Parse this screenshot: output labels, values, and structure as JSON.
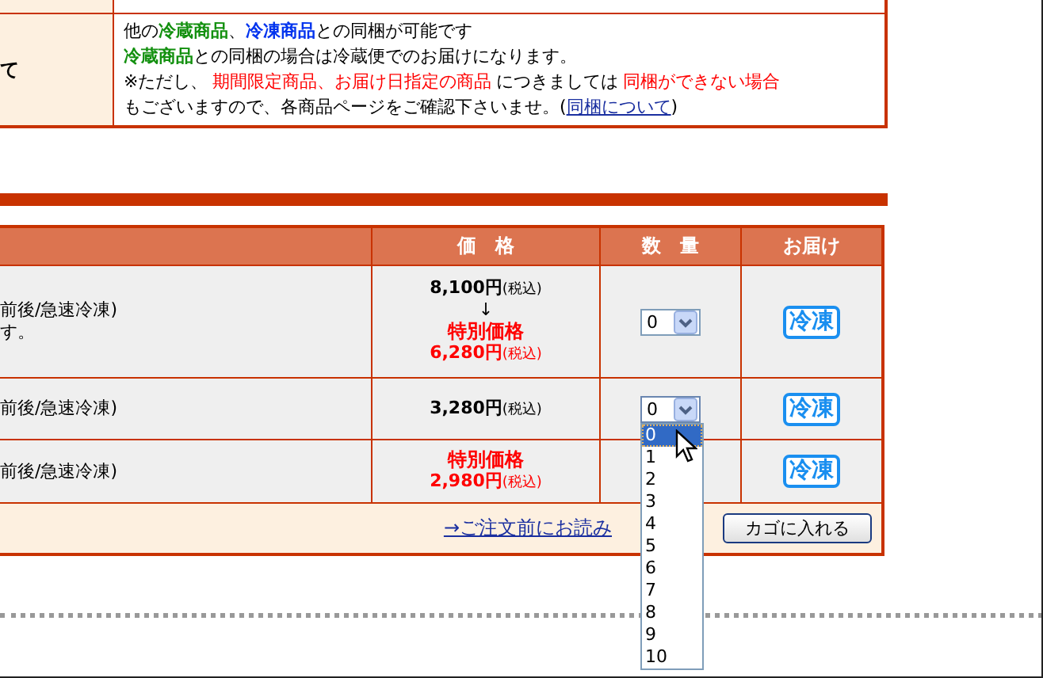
{
  "shipping_note": {
    "label": "て",
    "lines": [
      [
        {
          "text": "他の",
          "kind": "plain"
        },
        {
          "text": "冷蔵商品",
          "kind": "refrigerated"
        },
        {
          "text": "、",
          "kind": "plain"
        },
        {
          "text": "冷凍商品",
          "kind": "frozen"
        },
        {
          "text": "との同梱が可能です",
          "kind": "plain"
        }
      ],
      [
        {
          "text": "冷蔵商品",
          "kind": "refrigerated"
        },
        {
          "text": "との同梱の場合は冷蔵便でのお届けになります。",
          "kind": "plain"
        }
      ],
      [
        {
          "text": "※ただし、",
          "kind": "plain"
        },
        {
          "text": "期間限定商品、お届け日指定の商品",
          "kind": "warning"
        },
        {
          "text": "につきましては",
          "kind": "plain"
        },
        {
          "text": "同梱ができない場合",
          "kind": "warning"
        }
      ],
      [
        {
          "text": "もございますので、各商品ページをご確認下さいませ。(",
          "kind": "plain"
        },
        {
          "text": "同梱について",
          "kind": "link"
        },
        {
          "text": ")",
          "kind": "plain"
        }
      ]
    ]
  },
  "products": {
    "columns": [
      "価　格",
      "数　量",
      "お届け"
    ],
    "rows": [
      {
        "description": [
          "前後/急速冷凍)",
          "す。"
        ],
        "price": [
          {
            "kind": "regular",
            "amount": "8,100円",
            "tax": "(税込)"
          },
          {
            "kind": "arrow",
            "amount": "↓"
          },
          {
            "kind": "special_label",
            "amount": "特別価格"
          },
          {
            "kind": "special_price",
            "amount": "6,280円",
            "tax": "(税込)"
          }
        ],
        "quantity": "0",
        "delivery": "冷凍"
      },
      {
        "description": [
          "前後/急速冷凍)"
        ],
        "price": [
          {
            "kind": "regular",
            "amount": "3,280円",
            "tax": "(税込)"
          }
        ],
        "quantity": "0",
        "delivery": "冷凍",
        "dropdown_open": true
      },
      {
        "description": [
          "前後/急速冷凍)"
        ],
        "price": [
          {
            "kind": "special_label",
            "amount": "特別価格"
          },
          {
            "kind": "special_price",
            "amount": "2,980円",
            "tax": "(税込)"
          }
        ],
        "delivery": "冷凍"
      }
    ],
    "footer_link": "→ご注文前にお読み",
    "cart_button": "カゴに入れる"
  },
  "quantity_options": [
    {
      "label": "0",
      "selected": true
    },
    {
      "label": "1",
      "selected": false
    },
    {
      "label": "2",
      "selected": false
    },
    {
      "label": "3",
      "selected": false
    },
    {
      "label": "4",
      "selected": false
    },
    {
      "label": "5",
      "selected": false
    },
    {
      "label": "6",
      "selected": false
    },
    {
      "label": "7",
      "selected": false
    },
    {
      "label": "8",
      "selected": false
    },
    {
      "label": "9",
      "selected": false
    },
    {
      "label": "10",
      "selected": false
    }
  ]
}
